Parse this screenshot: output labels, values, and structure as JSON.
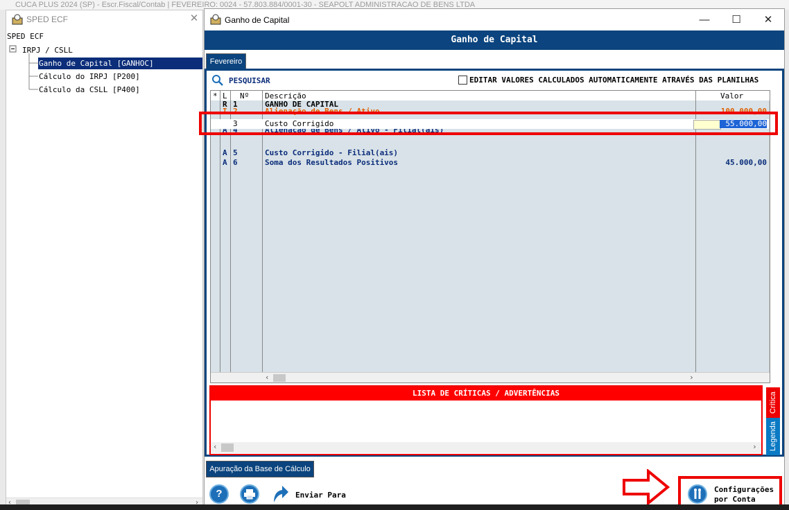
{
  "background_app": {
    "title": "CUCA PLUS 2024 (SP) - Escr.Fiscal/Contab | FEVEREIRO: 0024 - 57.803.884/0001-30 - SEAPOLT ADMINISTRACAO DE BENS LTDA"
  },
  "left_panel": {
    "title": "SPED ECF",
    "close_label": "✕",
    "tree": {
      "root": "SPED ECF",
      "group": "IRPJ / CSLL",
      "items": [
        "Ganho de Capital [GANHOC]",
        "Cálculo do IRPJ [P200]",
        "Cálculo da CSLL [P400]"
      ]
    }
  },
  "window": {
    "title": "Ganho de Capital",
    "buttons": {
      "minimize": "—",
      "maximize": "☐",
      "close": "✕"
    }
  },
  "form": {
    "header": "Ganho de Capital",
    "tab": "Fevereiro",
    "search_label": "PESQUISAR",
    "checkbox_label": "EDITAR VALORES CALCULADOS AUTOMATICAMENTE ATRAVÉS DAS PLANILHAS",
    "checkbox_checked": false,
    "grid": {
      "columns": {
        "flag": "*",
        "l": "L",
        "n": "Nº",
        "descricao": "Descrição",
        "valor": "Valor"
      },
      "rows": [
        {
          "l": "R",
          "n": "1",
          "descricao": "GANHO DE CAPITAL",
          "valor": "",
          "color": "#000000"
        },
        {
          "l": "I",
          "n": "2",
          "descricao": "Alienação de Bens / Ativo",
          "valor": "100.000,00",
          "color": "#e06000"
        },
        {
          "l": "",
          "n": "3",
          "descricao": "Custo Corrigido",
          "valor": "55.000,00",
          "color": "#000000"
        },
        {
          "l": "A",
          "n": "4",
          "descricao": "Alienação de Bens / Ativo - Filial(ais)",
          "valor": "",
          "color": "#0b2d7a"
        },
        {
          "l": "A",
          "n": "5",
          "descricao": "Custo Corrigido - Filial(ais)",
          "valor": "",
          "color": "#0b2d7a"
        },
        {
          "l": "A",
          "n": "6",
          "descricao": "Soma dos Resultados Positivos",
          "valor": "45.000,00",
          "color": "#0b2d7a"
        }
      ]
    },
    "critics": {
      "title": "LISTA DE CRÍTICAS / ADVERTÊNCIAS",
      "side_tabs": [
        "Crítica",
        "Legenda"
      ]
    },
    "bottom_tab": "Apuração da Base de Cálculo",
    "toolbar": {
      "help_icon": "?",
      "send_label": "Enviar Para",
      "config_label_1": "Configurações",
      "config_label_2": "por Conta"
    }
  },
  "colors": {
    "brand_blue": "#0b447e",
    "highlight_red": "#e00000",
    "selection": "#0b2d7a"
  }
}
